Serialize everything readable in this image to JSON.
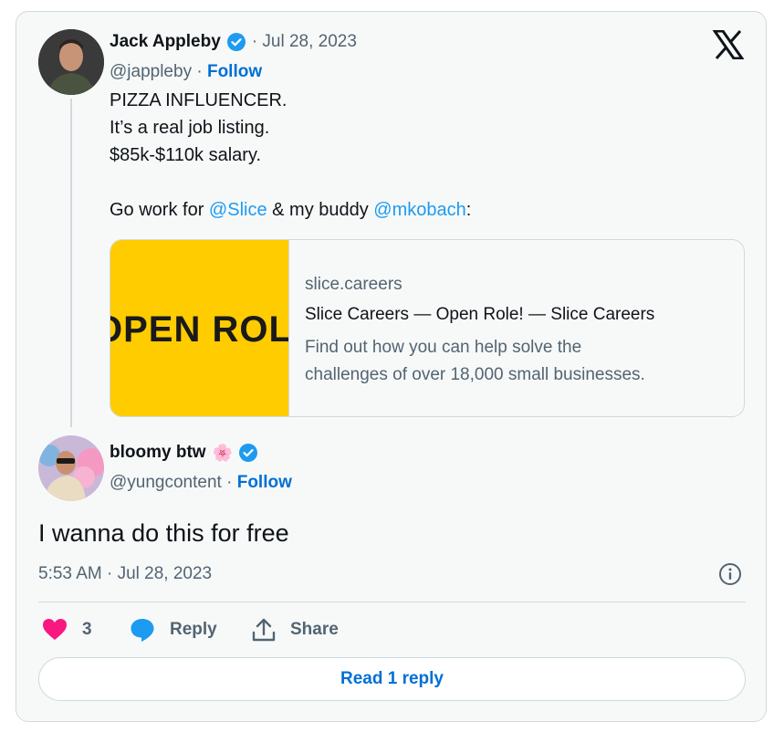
{
  "tweet": {
    "author_name": "Jack Appleby",
    "date": "· Jul 28, 2023",
    "handle": "@jappleby",
    "follow_label": "Follow",
    "line1": "PIZZA INFLUENCER.",
    "line2": "It’s a real job listing.",
    "line3": "$85k-$110k salary.",
    "line4_prefix": "Go work for ",
    "mention1": "@Slice",
    "line4_middle": " & my buddy ",
    "mention2": "@mkobach",
    "line4_suffix": ":"
  },
  "link_card": {
    "image_text": "OPEN ROLE",
    "domain": "slice.careers",
    "title": "Slice Careers — Open Role! — Slice Careers",
    "description_line1": "Find out how you can help solve the",
    "description_line2": "challenges of over 18,000 small businesses."
  },
  "reply": {
    "author_name": "bloomy btw",
    "emoji": "🌸",
    "handle": "@yungcontent",
    "follow_label": "Follow",
    "text": "I wanna do this for free",
    "timestamp": "5:53 AM · Jul 28, 2023"
  },
  "actions": {
    "like_count": "3",
    "reply_label": "Reply",
    "share_label": "Share",
    "read_replies_label": "Read 1 reply"
  },
  "colors": {
    "accent": "#1d9bf0",
    "follow": "#006fd6",
    "like": "#f91880",
    "card_image": "#ffcc00"
  }
}
